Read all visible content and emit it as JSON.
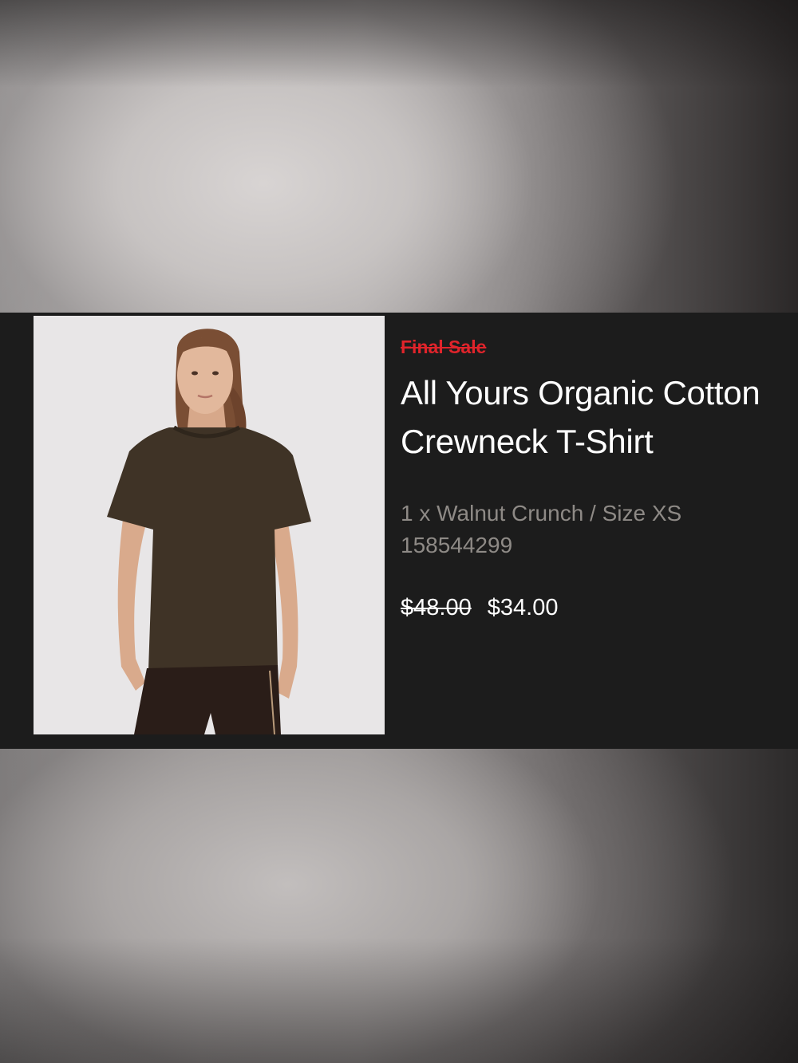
{
  "product": {
    "badge": "Final Sale",
    "title": "All Yours Organic Cotton Crewneck T-Shirt",
    "variant": "1 x Walnut Crunch / Size XS",
    "sku": "158544299",
    "price_original": "$48.00",
    "price_sale": "$34.00",
    "image_description": "model-wearing-brown-tshirt"
  },
  "colors": {
    "badge": "#e0242b",
    "card_background": "#1c1c1c",
    "title": "#ffffff",
    "meta_text": "#8e8a86",
    "shirt": "#3f3326"
  }
}
